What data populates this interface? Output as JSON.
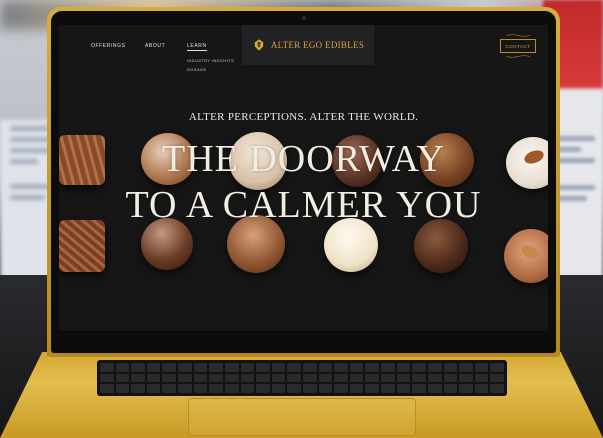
{
  "site": {
    "nav_links": [
      "OFFERINGS",
      "ABOUT",
      "LEARN"
    ],
    "submenu": [
      "INDUSTRY INSIGHTS",
      "DOSAGE"
    ],
    "logo_text": "ALTER EGO EDIBLES",
    "contact_label": "CONTACT",
    "tagline": "ALTER PERCEPTIONS. ALTER THE WORLD.",
    "headline_line1": "THE DOORWAY",
    "headline_line2": "TO A CALMER YOU"
  },
  "colors": {
    "laptop_gold": "#d4a734",
    "site_background": "#161617",
    "brand_gold": "#d9a441",
    "text_cream": "#f2ede3"
  },
  "icons": [
    "alter-ego-logo-icon"
  ]
}
